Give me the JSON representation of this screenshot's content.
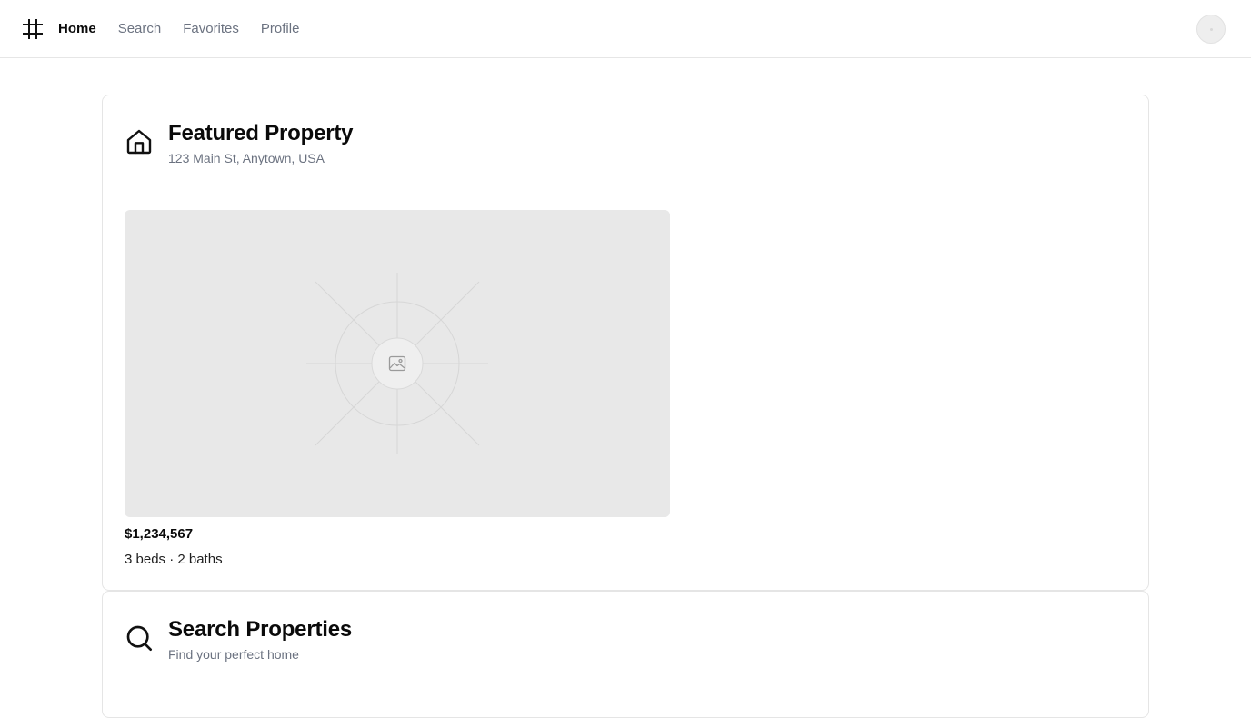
{
  "nav": {
    "logo_icon": "hash-icon",
    "items": [
      {
        "label": "Home",
        "active": true
      },
      {
        "label": "Search",
        "active": false
      },
      {
        "label": "Favorites",
        "active": false
      },
      {
        "label": "Profile",
        "active": false
      }
    ],
    "avatar": "avatar"
  },
  "featured": {
    "icon": "home-icon",
    "title": "Featured Property",
    "address": "123 Main St, Anytown, USA",
    "image_icon": "image-icon",
    "price": "$1,234,567",
    "specs": "3 beds · 2 baths"
  },
  "search": {
    "icon": "search-icon",
    "title": "Search Properties",
    "subtitle": "Find your perfect home"
  },
  "colors": {
    "text_primary": "#0a0a0a",
    "text_muted": "#6b7280",
    "border": "#e5e5e5",
    "placeholder_bg": "#e8e8e8"
  }
}
